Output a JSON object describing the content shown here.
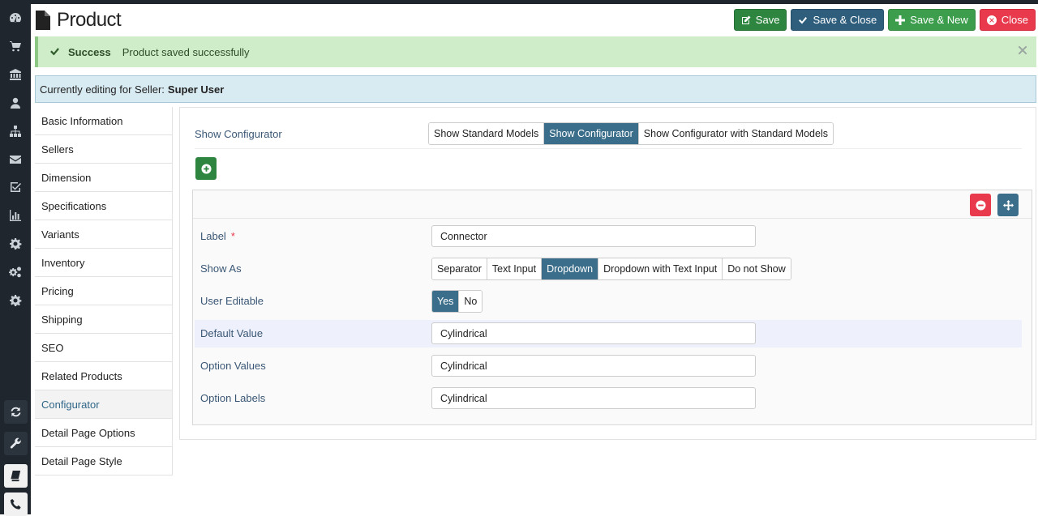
{
  "page": {
    "title": "Product"
  },
  "toolbar": {
    "save": "Save",
    "save_close": "Save & Close",
    "save_new": "Save & New",
    "close": "Close"
  },
  "alert": {
    "heading": "Success",
    "message": "Product saved successfully"
  },
  "editing": {
    "prefix": "Currently editing for Seller:",
    "seller": "Super User"
  },
  "sidenav": {
    "items": [
      {
        "label": "Basic Information"
      },
      {
        "label": "Sellers"
      },
      {
        "label": "Dimension"
      },
      {
        "label": "Specifications"
      },
      {
        "label": "Variants"
      },
      {
        "label": "Inventory"
      },
      {
        "label": "Pricing"
      },
      {
        "label": "Shipping"
      },
      {
        "label": "SEO"
      },
      {
        "label": "Related Products"
      },
      {
        "label": "Configurator",
        "active": true
      },
      {
        "label": "Detail Page Options"
      },
      {
        "label": "Detail Page Style"
      }
    ]
  },
  "configurator": {
    "mode_label": "Show Configurator",
    "modes": [
      "Show Standard Models",
      "Show Configurator",
      "Show Configurator with Standard Models"
    ],
    "selected_mode": "Show Configurator",
    "fields": {
      "label": {
        "label": "Label",
        "required_mark": "*",
        "value": "Connector"
      },
      "show_as": {
        "label": "Show As",
        "options": [
          "Separator",
          "Text Input",
          "Dropdown",
          "Dropdown with Text Input",
          "Do not Show"
        ],
        "selected": "Dropdown"
      },
      "user_editable": {
        "label": "User Editable",
        "options": [
          "Yes",
          "No"
        ],
        "selected": "Yes"
      },
      "default_value": {
        "label": "Default Value",
        "value": "Cylindrical"
      },
      "option_values": {
        "label": "Option Values",
        "value": "Cylindrical"
      },
      "option_labels": {
        "label": "Option Labels",
        "value": "Cylindrical"
      }
    }
  },
  "icons": {
    "rail": [
      "dashboard-icon",
      "cart-icon",
      "bank-icon",
      "user-icon",
      "sitemap-icon",
      "envelope-icon",
      "check-square-icon",
      "bar-chart-icon",
      "gear-icon",
      "gears-icon",
      "gear-icon",
      "refresh-icon",
      "wrench-icon",
      "book-icon",
      "phone-icon"
    ]
  },
  "colors": {
    "rail_bg": "#1f262d",
    "success": "#2e8540",
    "primary": "#2f5e7d",
    "danger": "#e8394d",
    "alert_bg": "#d0edc9",
    "info_bg": "#d9ebf2"
  }
}
